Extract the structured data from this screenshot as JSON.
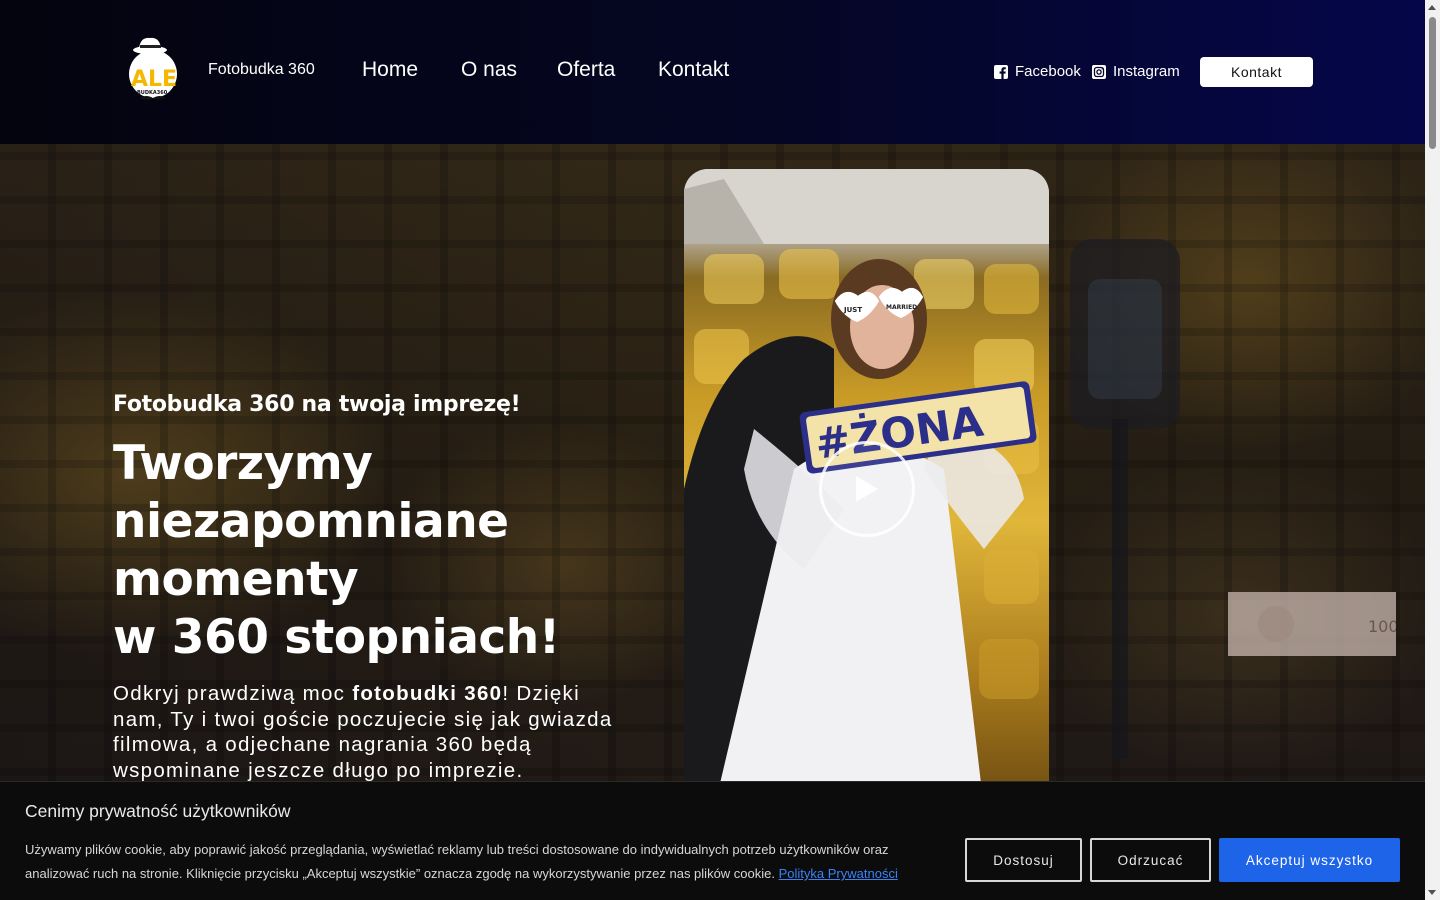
{
  "header": {
    "brand": "Fotobudka 360",
    "logo_text": "ALE",
    "logo_subtext": "BUDKA360",
    "nav": [
      "Home",
      "O nas",
      "Oferta",
      "Kontakt"
    ],
    "social": [
      {
        "label": "Facebook",
        "icon": "facebook-icon"
      },
      {
        "label": "Instagram",
        "icon": "instagram-icon"
      }
    ],
    "cta_label": "Kontakt",
    "accent_logo": "#f5b800"
  },
  "hero": {
    "kicker": "Fotobudka 360 na twoją imprezę!",
    "title_lines": [
      "Tworzymy",
      "niezapomniane",
      "momenty",
      "w 360 stopniach!"
    ],
    "desc_before": "Odkryj prawdziwą moc ",
    "desc_bold": "fotobudki 360",
    "desc_after": "! Dzięki nam, Ty i twoi goście poczujecie się jak gwiazda filmowa, a odjechane nagrania 360 będą wspominane jeszcze długo po imprezie.",
    "video_sign": "#ŻONA",
    "video_glasses": [
      "JUST",
      "MARRIED"
    ],
    "play_icon": "play-icon",
    "bill_value": "100"
  },
  "cookie": {
    "title": "Cenimy prywatność użytkowników",
    "text": "Używamy plików cookie, aby poprawić jakość przeglądania, wyświetlać reklamy lub treści dostosowane do indywidualnych potrzeb użytkowników oraz analizować ruch na stronie. Kliknięcie przycisku „Akceptuj wszystkie” oznacza zgodę na wykorzystywanie przez nas plików cookie.",
    "link": "Polityka Prywatności",
    "buttons": {
      "customize": "Dostosuj",
      "reject": "Odrzucać",
      "accept": "Akceptuj wszystko"
    },
    "accent": "#1e64e8"
  }
}
